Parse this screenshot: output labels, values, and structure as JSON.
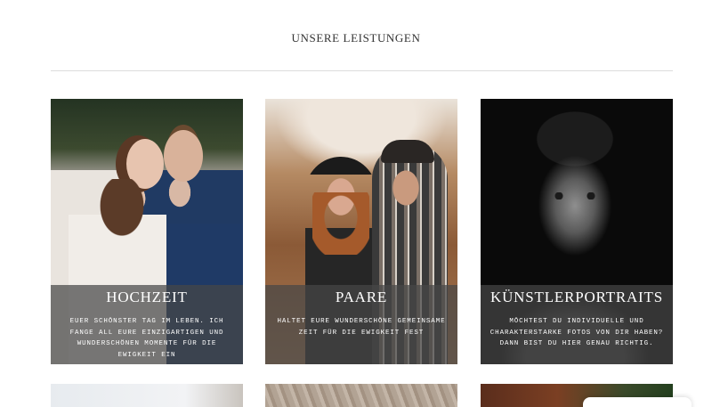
{
  "section": {
    "title": "UNSERE LEISTUNGEN"
  },
  "services": [
    {
      "title": "HOCHZEIT",
      "description": "EUER SCHÖNSTER TAG IM LEBEN. ICH FANGE ALL EURE EINZIGARTIGEN UND WUNDERSCHÖNEN MOMENTE FÜR DIE EWIGKEIT EIN"
    },
    {
      "title": "PAARE",
      "description": "HALTET EURE WUNDERSCHÖNE GEMEINSAME ZEIT FÜR DIE EWIGKEIT FEST"
    },
    {
      "title": "KÜNSTLERPORTRAITS",
      "description": "MÖCHTEST DU INDIVIDUELLE UND CHARAKTERSTARKE FOTOS VON DIR HABEN? DANN BIST DU HIER GENAU RICHTIG."
    }
  ],
  "colors": {
    "overlay": "#464646",
    "divider": "#dcdcdc",
    "text": "#333333"
  }
}
